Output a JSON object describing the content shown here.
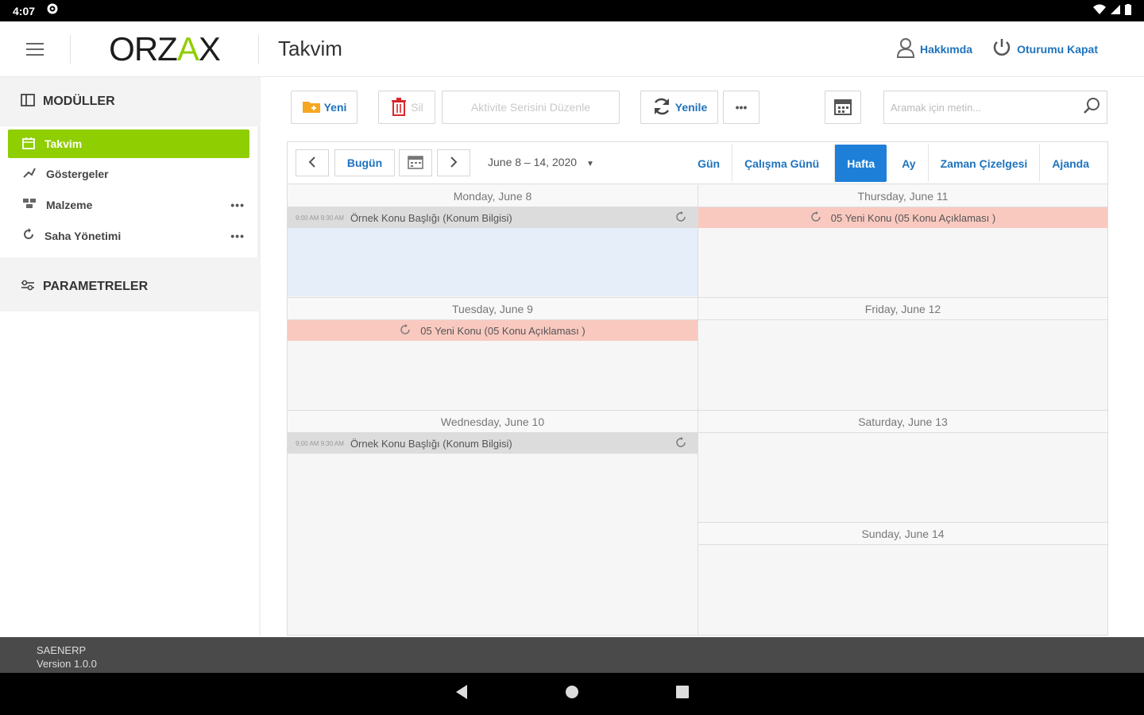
{
  "status_bar": {
    "time": "4:07"
  },
  "header": {
    "logo_text_a": "ORZ",
    "logo_text_accent": "A",
    "logo_text_b": "X",
    "title": "Takvim",
    "about_label": "Hakkımda",
    "logout_label": "Oturumu Kapat"
  },
  "sidebar": {
    "modules_title": "MODÜLLER",
    "items": [
      {
        "label": "Takvim",
        "icon": "calendar-icon",
        "active": true
      },
      {
        "label": "Göstergeler",
        "icon": "gauge-icon",
        "has_more": false
      },
      {
        "label": "Malzeme",
        "icon": "boxes-icon",
        "has_more": true
      },
      {
        "label": "Saha Yönetimi",
        "icon": "refresh-icon",
        "has_more": true
      }
    ],
    "more_label": "•••",
    "params_title": "PARAMETRELER"
  },
  "toolbar": {
    "new_label": "Yeni",
    "delete_label": "Sil",
    "edit_series_label": "Aktivite Serisini Düzenle",
    "refresh_label": "Yenile",
    "more_label": "•••",
    "search_placeholder": "Aramak için metin..."
  },
  "scheduler": {
    "today_label": "Bugün",
    "date_range": "June 8 – 14, 2020",
    "views": [
      "Gün",
      "Çalışma Günü",
      "Hafta",
      "Ay",
      "Zaman Çizelgesi",
      "Ajanda"
    ],
    "active_view": "Hafta",
    "days": [
      {
        "header": "Monday, June 8",
        "appt": {
          "time": "9:00 AM 9:30 AM",
          "text": "Örnek Konu Başlığı (Konum Bilgisi)",
          "style": "grey"
        }
      },
      {
        "header": "Tuesday, June 9",
        "appt": {
          "text": "05 Yeni Konu (05 Konu Açıklaması )",
          "style": "red"
        }
      },
      {
        "header": "Wednesday, June 10",
        "appt": {
          "time": "9:00 AM 9:30 AM",
          "text": "Örnek Konu Başlığı (Konum Bilgisi)",
          "style": "grey"
        }
      },
      {
        "header": "Thursday, June 11",
        "appt": {
          "text": "05 Yeni Konu (05 Konu Açıklaması )",
          "style": "red"
        }
      },
      {
        "header": "Friday, June 12"
      },
      {
        "header": "Saturday, June 13"
      },
      {
        "header": "Sunday, June 14"
      }
    ]
  },
  "footer": {
    "app_name": "SAENERP",
    "version": "Version 1.0.0"
  },
  "colors": {
    "accent": "#8fce00",
    "link": "#1e73be",
    "active_view": "#1e7fd8",
    "appt_red": "#f9c9c0",
    "appt_grey": "#dcdcdc"
  }
}
